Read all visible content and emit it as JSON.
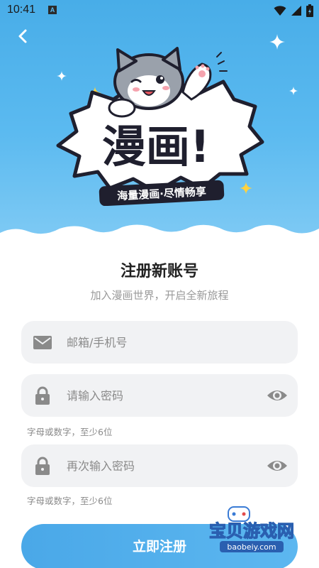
{
  "status_bar": {
    "time": "10:41",
    "notification_glyph": "A"
  },
  "hero": {
    "logo_text": "漫画!",
    "tagline": "海量漫画·尽情畅享",
    "tagline_highlight": "海量"
  },
  "form": {
    "title": "注册新账号",
    "subtitle": "加入漫画世界，开启全新旅程",
    "email_placeholder": "邮箱/手机号",
    "password_placeholder": "请输入密码",
    "password_hint": "字母或数字，至少6位",
    "confirm_placeholder": "再次输入密码",
    "confirm_hint": "字母或数字，至少6位",
    "submit_label": "立即注册"
  },
  "watermark": {
    "brand": "宝贝游戏网",
    "url": "baobeiy.com"
  },
  "colors": {
    "accent": "#4aa8e8",
    "hero_bg": "#5bbaf0",
    "field_bg": "#f1f2f4",
    "tagline_highlight": "#ffd23f"
  }
}
